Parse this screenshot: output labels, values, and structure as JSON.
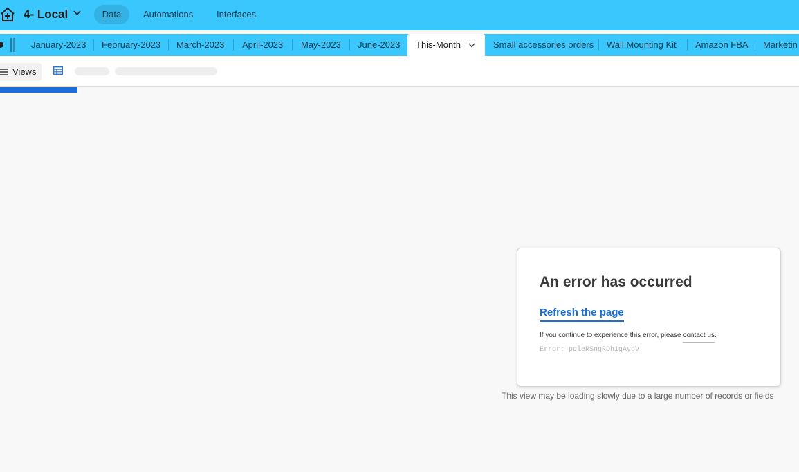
{
  "header": {
    "base_name": "4- Local",
    "nav": {
      "data": "Data",
      "automations": "Automations",
      "interfaces": "Interfaces"
    }
  },
  "tabs": {
    "items": [
      "January-2023",
      "February-2023",
      "March-2023",
      "April-2023",
      "May-2023",
      "June-2023",
      "This-Month",
      "Small accessories orders",
      "Wall Mounting Kit",
      "Amazon FBA",
      "Marketin"
    ],
    "active": "This-Month"
  },
  "viewbar": {
    "views_label": "Views"
  },
  "error": {
    "title": "An error has occurred",
    "refresh_label": "Refresh the page",
    "message_prefix": "If you continue to experience this error, please ",
    "contact_label": "contact us",
    "message_suffix": ".",
    "code": "Error: pgleRSngRDh1gAyoV"
  },
  "slow_note": "This view may be loading slowly due to a large number of records or fields",
  "colors": {
    "topbar": "#39c7fd",
    "accent": "#1a6fd6",
    "background": "#f8f8f8"
  },
  "icons": {
    "home": "home-plus-icon",
    "base_menu": "chevron-down-icon",
    "views": "hamburger-icon",
    "grid": "grid-view-icon"
  }
}
